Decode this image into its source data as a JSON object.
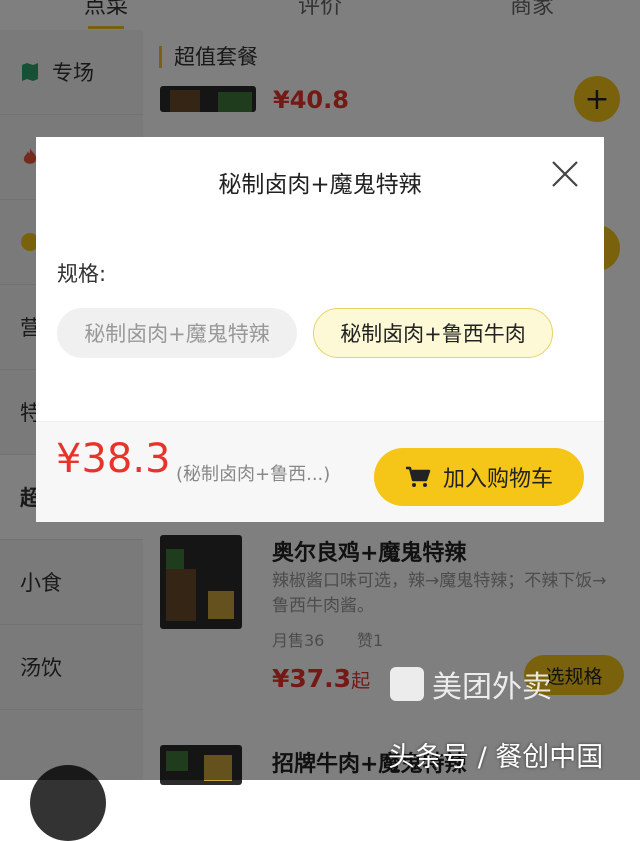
{
  "tabs": [
    "点菜",
    "评价",
    "商家"
  ],
  "sidebar": {
    "items": [
      {
        "label": "专场",
        "icon": "flag-icon"
      },
      {
        "label": "",
        "icon": "fire-icon"
      },
      {
        "label": "",
        "icon": "badge-icon"
      },
      {
        "label": "营"
      },
      {
        "label": "特"
      },
      {
        "label": "超"
      },
      {
        "label": "小食"
      },
      {
        "label": "汤饮"
      }
    ]
  },
  "section": {
    "title": "超值套餐",
    "top_price": "¥40.8"
  },
  "products": [
    {
      "name": "奥尔良鸡+魔鬼特辣",
      "desc": "辣椒酱口味可选，辣→魔鬼特辣；不辣下饭→鲁西牛肉酱。",
      "sales": "月售36",
      "likes": "赞1",
      "price": "¥37.3",
      "price_suffix": "起",
      "button": "选规格"
    },
    {
      "name": "招牌牛肉+魔鬼特辣"
    }
  ],
  "modal": {
    "title": "秘制卤肉+魔鬼特辣",
    "spec_label": "规格:",
    "options": [
      {
        "label": "秘制卤肉+魔鬼特辣",
        "state": "disabled"
      },
      {
        "label": "秘制卤肉+鲁西牛肉",
        "state": "selected"
      }
    ],
    "price": "¥38.3",
    "selected_spec": "(秘制卤肉+鲁西...)",
    "cart_button": "加入购物车"
  },
  "watermarks": {
    "meituan": "美团外卖",
    "toutiao": "头条号 / 餐创中国"
  },
  "colors": {
    "accent": "#f5c518",
    "price": "#e8332a"
  }
}
